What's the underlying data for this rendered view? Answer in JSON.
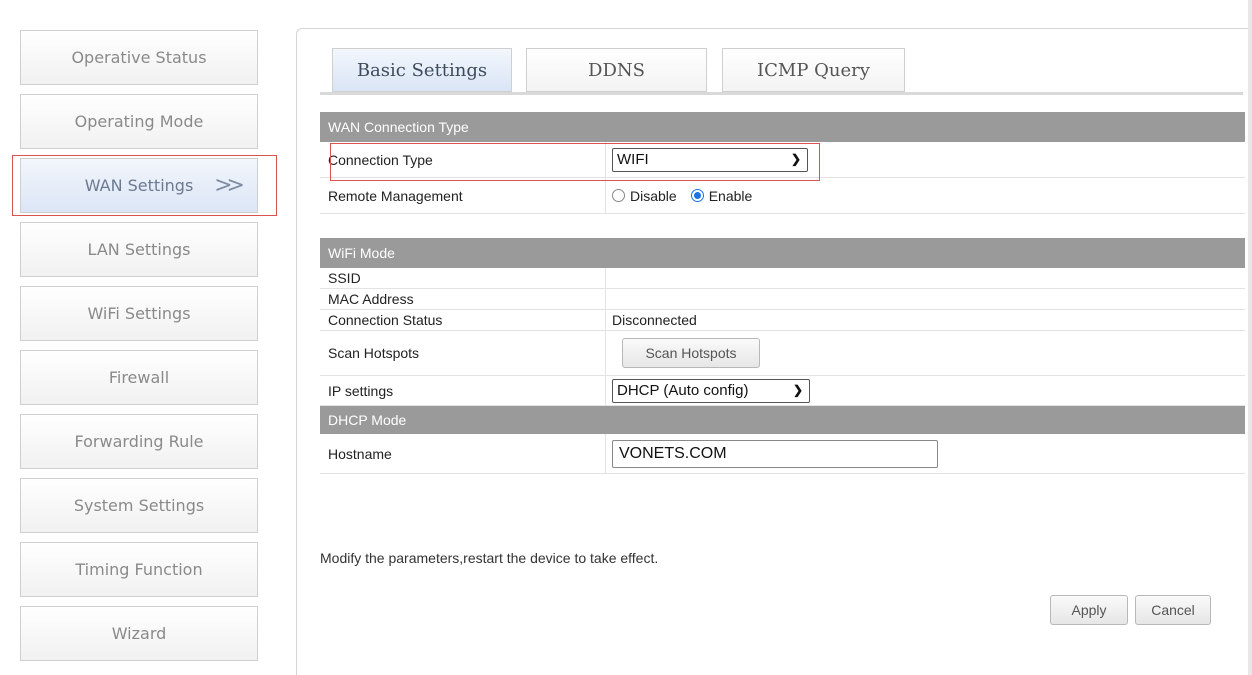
{
  "sidebar": {
    "items": [
      {
        "label": "Operative Status"
      },
      {
        "label": "Operating Mode"
      },
      {
        "label": "WAN Settings",
        "arrow": ">>"
      },
      {
        "label": "LAN Settings"
      },
      {
        "label": "WiFi Settings"
      },
      {
        "label": "Firewall"
      },
      {
        "label": "Forwarding Rule"
      },
      {
        "label": "System Settings"
      },
      {
        "label": "Timing Function"
      },
      {
        "label": "Wizard"
      }
    ],
    "active_index": 2
  },
  "tabs": [
    {
      "label": "Basic Settings"
    },
    {
      "label": "DDNS"
    },
    {
      "label": "ICMP Query"
    }
  ],
  "sections": {
    "wan": {
      "header": "WAN Connection Type",
      "connection_type_label": "Connection Type",
      "connection_type_value": "WIFI",
      "remote_mgmt_label": "Remote Management",
      "remote_options": [
        "Disable",
        "Enable"
      ],
      "remote_selected": "Enable"
    },
    "wifi": {
      "header": "WiFi Mode",
      "ssid_label": "SSID",
      "ssid_value": "",
      "mac_label": "MAC Address",
      "mac_value": "",
      "status_label": "Connection Status",
      "status_value": "Disconnected",
      "scan_label": "Scan Hotspots",
      "scan_button": "Scan Hotspots",
      "ip_label": "IP settings",
      "ip_value": "DHCP (Auto config)"
    },
    "dhcp": {
      "header": "DHCP Mode",
      "hostname_label": "Hostname",
      "hostname_value": "VONETS.COM"
    }
  },
  "note": "Modify the parameters,restart the device to take effect.",
  "actions": {
    "apply": "Apply",
    "cancel": "Cancel"
  },
  "colors": {
    "section_header_bg": "#9a9a9a",
    "highlight_border": "#d9534f",
    "radio_checked": "#1a73e8"
  }
}
